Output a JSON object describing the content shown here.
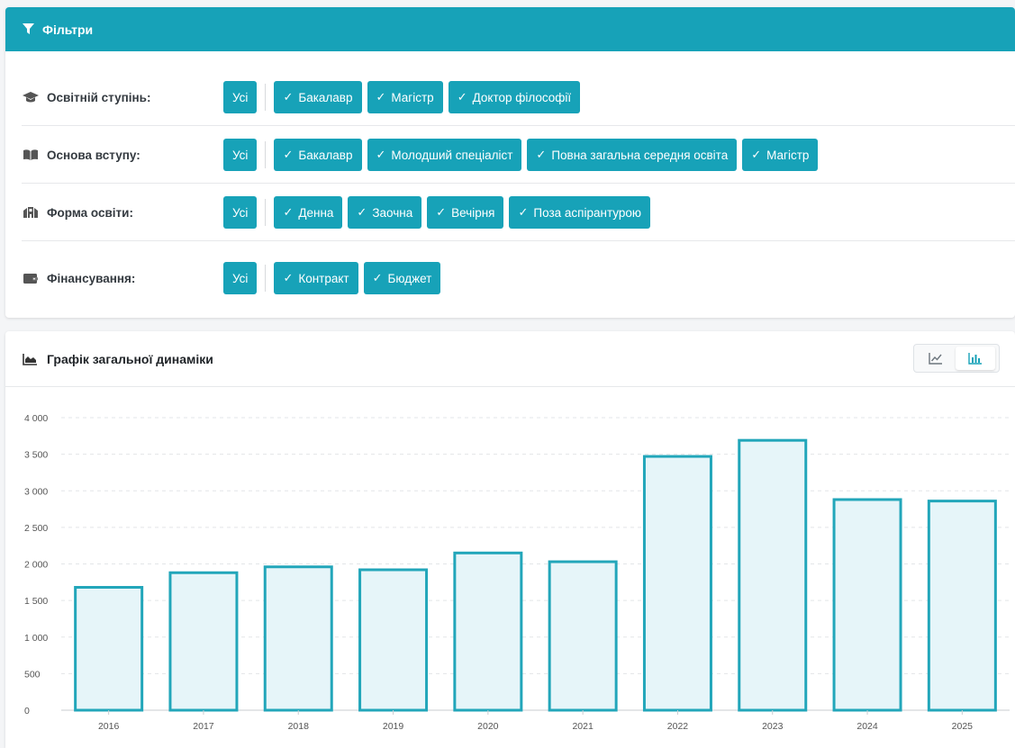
{
  "filters": {
    "title": "Фільтри",
    "rows": [
      {
        "label": "Освітній ступінь:",
        "icon": "graduation-cap-icon",
        "all_label": "Усі",
        "options": [
          "Бакалавр",
          "Магістр",
          "Доктор філософії"
        ]
      },
      {
        "label": "Основа вступу:",
        "icon": "book-open-icon",
        "all_label": "Усі",
        "options": [
          "Бакалавр",
          "Молодший спеціаліст",
          "Повна загальна середня освіта",
          "Магістр"
        ]
      },
      {
        "label": "Форма освіти:",
        "icon": "building-icon",
        "all_label": "Усі",
        "options": [
          "Денна",
          "Заочна",
          "Вечірня",
          "Поза аспірантурою"
        ]
      },
      {
        "label": "Фінансування:",
        "icon": "wallet-icon",
        "all_label": "Усі",
        "options": [
          "Контракт",
          "Бюджет"
        ]
      }
    ]
  },
  "chart_panel": {
    "title": "Графік загальної динаміки",
    "view_modes": [
      "line",
      "bar"
    ],
    "active_view": "bar"
  },
  "colors": {
    "accent": "#17a2b8",
    "bar_fill": "#e6f5f9",
    "bar_stroke": "#22a6ba"
  },
  "chart_data": {
    "type": "bar",
    "categories": [
      "2016",
      "2017",
      "2018",
      "2019",
      "2020",
      "2021",
      "2022",
      "2023",
      "2024",
      "2025"
    ],
    "values": [
      1680,
      1880,
      1960,
      1920,
      2150,
      2030,
      3470,
      3690,
      2880,
      2860
    ],
    "ylim": [
      0,
      4000
    ],
    "yticks": [
      0,
      500,
      1000,
      1500,
      2000,
      2500,
      3000,
      3500,
      4000
    ],
    "ytick_labels": [
      "0",
      "500",
      "1 000",
      "1 500",
      "2 000",
      "2 500",
      "3 000",
      "3 500",
      "4 000"
    ],
    "grid": true,
    "title": "",
    "xlabel": "",
    "ylabel": ""
  }
}
